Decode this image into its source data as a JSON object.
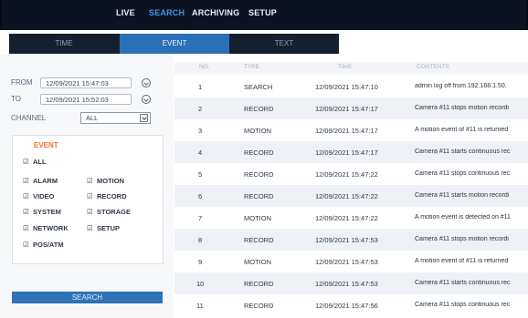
{
  "topnav": {
    "items": [
      {
        "label": "LIVE"
      },
      {
        "label": "SEARCH"
      },
      {
        "label": "ARCHIVING"
      },
      {
        "label": "SETUP"
      }
    ],
    "active_color": "#3e95e0"
  },
  "tabs": [
    {
      "label": "TIME"
    },
    {
      "label": "EVENT"
    },
    {
      "label": "TEXT"
    }
  ],
  "filters": {
    "from_label": "FROM",
    "from_value": "12/09/2021 15:47:03",
    "to_label": "TO",
    "to_value": "12/09/2021 15:52:03",
    "channel_label": "CHANNEL",
    "channel_value": "ALL"
  },
  "event": {
    "title": "EVENT",
    "options": [
      {
        "label": "ALL",
        "checked": true
      },
      {
        "label": "ALARM",
        "checked": true
      },
      {
        "label": "MOTION",
        "checked": true
      },
      {
        "label": "VIDEO",
        "checked": true
      },
      {
        "label": "RECORD",
        "checked": true
      },
      {
        "label": "SYSTEM",
        "checked": true
      },
      {
        "label": "STORAGE",
        "checked": true
      },
      {
        "label": "NETWORK",
        "checked": true
      },
      {
        "label": "SETUP",
        "checked": true
      },
      {
        "label": "POS/ATM",
        "checked": true
      }
    ]
  },
  "search_button": "SEARCH",
  "table": {
    "headers": [
      "NO.",
      "TYPE",
      "TIME",
      "CONTENTS"
    ],
    "rows": [
      {
        "no": "1",
        "type": "SEARCH",
        "time": "12/09/2021 15:47:10",
        "contents": "admin log off from 192.168.1.50."
      },
      {
        "no": "2",
        "type": "RECORD",
        "time": "12/09/2021 15:47:17",
        "contents": "Camera #11 stops motion recordi"
      },
      {
        "no": "3",
        "type": "MOTION",
        "time": "12/09/2021 15:47:17",
        "contents": "A motion event of #11 is returned"
      },
      {
        "no": "4",
        "type": "RECORD",
        "time": "12/09/2021 15:47:17",
        "contents": "Camera #11 starts continuous rec"
      },
      {
        "no": "5",
        "type": "RECORD",
        "time": "12/09/2021 15:47:22",
        "contents": "Camera #11 stops continuous rec"
      },
      {
        "no": "6",
        "type": "RECORD",
        "time": "12/09/2021 15:47:22",
        "contents": "Camera #11 starts motion recordi"
      },
      {
        "no": "7",
        "type": "MOTION",
        "time": "12/09/2021 15:47:22",
        "contents": "A motion event is detected on #11"
      },
      {
        "no": "8",
        "type": "RECORD",
        "time": "12/09/2021 15:47:53",
        "contents": "Camera #11 stops motion recordi"
      },
      {
        "no": "9",
        "type": "MOTION",
        "time": "12/09/2021 15:47:53",
        "contents": "A motion event of #11 is returned"
      },
      {
        "no": "10",
        "type": "RECORD",
        "time": "12/09/2021 15:47:53",
        "contents": "Camera #11 starts continuous rec"
      },
      {
        "no": "11",
        "type": "RECORD",
        "time": "12/09/2021 15:47:56",
        "contents": "Camera #11 stops continuous rec"
      }
    ]
  }
}
